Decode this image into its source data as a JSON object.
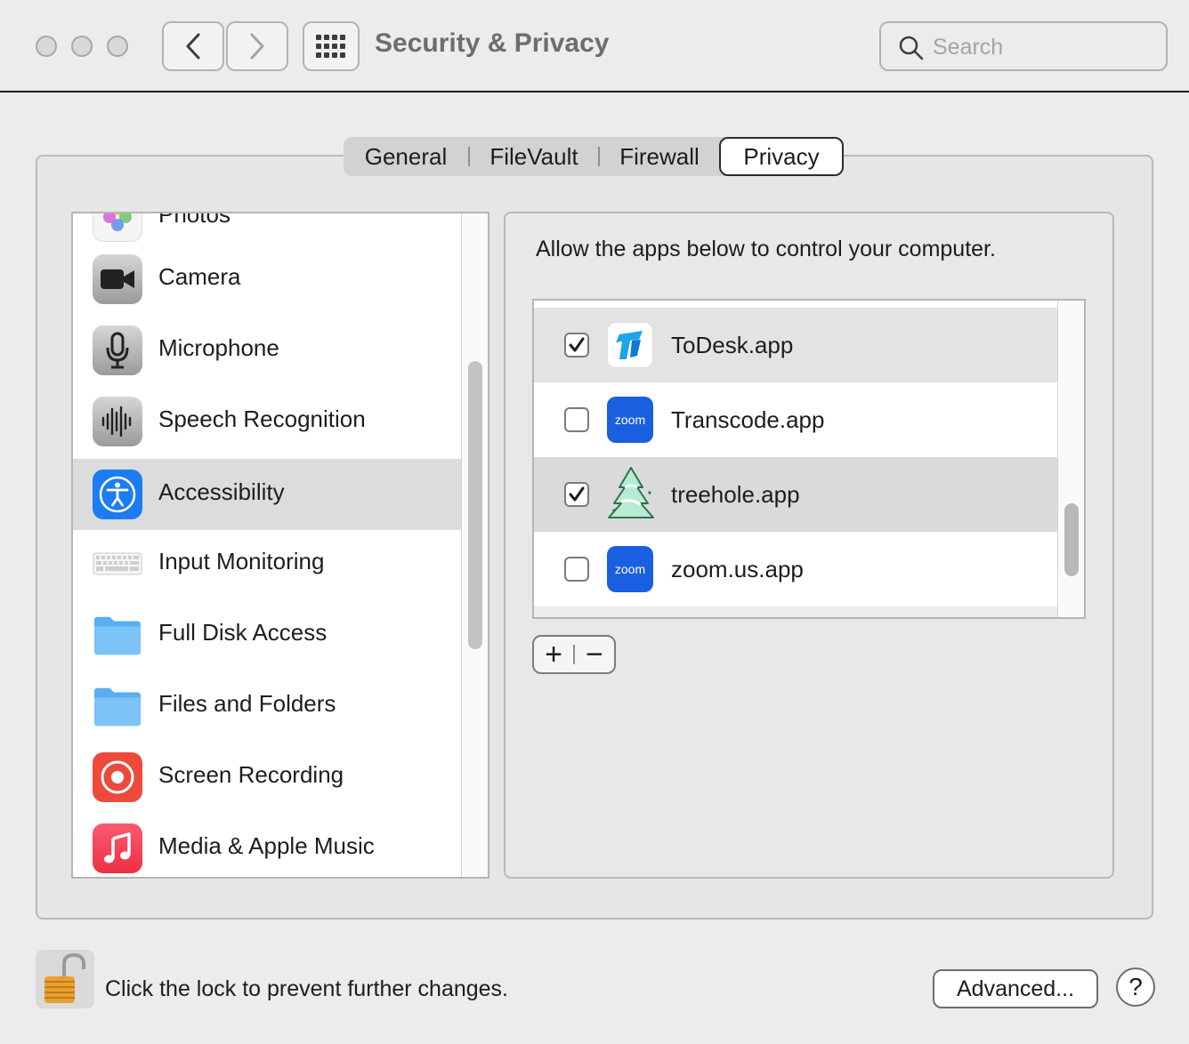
{
  "window": {
    "title": "Security & Privacy"
  },
  "search": {
    "placeholder": "Search"
  },
  "tabs": [
    {
      "label": "General"
    },
    {
      "label": "FileVault"
    },
    {
      "label": "Firewall"
    },
    {
      "label": "Privacy",
      "active": true
    }
  ],
  "sidebar": {
    "items": [
      {
        "label": "Photos",
        "icon": "photos-icon"
      },
      {
        "label": "Camera",
        "icon": "camera-icon"
      },
      {
        "label": "Microphone",
        "icon": "microphone-icon"
      },
      {
        "label": "Speech Recognition",
        "icon": "waveform-icon"
      },
      {
        "label": "Accessibility",
        "icon": "accessibility-icon",
        "selected": true
      },
      {
        "label": "Input Monitoring",
        "icon": "keyboard-icon"
      },
      {
        "label": "Full Disk Access",
        "icon": "folder-icon"
      },
      {
        "label": "Files and Folders",
        "icon": "folder-icon"
      },
      {
        "label": "Screen Recording",
        "icon": "screen-recording-icon"
      },
      {
        "label": "Media & Apple Music",
        "icon": "music-icon"
      }
    ]
  },
  "panel": {
    "description": "Allow the apps below to control your computer.",
    "apps": [
      {
        "label": "ToDesk.app",
        "checked": true,
        "icon": "todesk-icon"
      },
      {
        "label": "Transcode.app",
        "checked": false,
        "icon": "zoom-icon",
        "icon_text": "zoom"
      },
      {
        "label": "treehole.app",
        "checked": true,
        "icon": "tree-icon"
      },
      {
        "label": "zoom.us.app",
        "checked": false,
        "icon": "zoom-icon",
        "icon_text": "zoom"
      }
    ],
    "add_label": "+",
    "remove_label": "−"
  },
  "footer": {
    "lock_text": "Click the lock to prevent further changes.",
    "advanced_label": "Advanced...",
    "help_label": "?"
  },
  "colors": {
    "accent": "#1e7cf2",
    "zoom_blue": "#1a5fe0",
    "screen_recording_red": "#ee4a3b",
    "music_red": "#f0394f"
  }
}
